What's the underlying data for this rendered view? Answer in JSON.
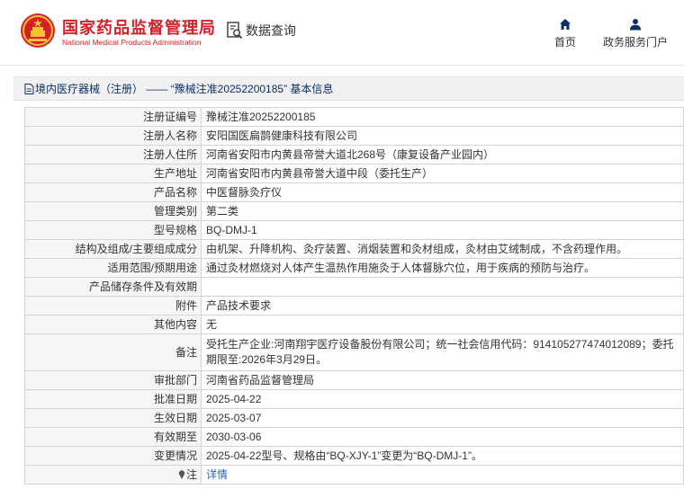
{
  "header": {
    "brand_cn": "国家药品监督管理局",
    "brand_en": "National Medical Products Administration",
    "query_label": "数据查询",
    "nav": [
      {
        "label": "首页",
        "icon": "home-icon"
      },
      {
        "label": "政务服务门户",
        "icon": "user-icon"
      }
    ]
  },
  "breadcrumb": {
    "text": "境内医疗器械（注册） —— “豫械注准20252200185” 基本信息"
  },
  "colors": {
    "brand_red": "#d4202a",
    "nav_blue": "#0b2f6b",
    "link_blue": "#2a64b6"
  },
  "rows": [
    {
      "key": "注册证编号",
      "value": "豫械注准20252200185"
    },
    {
      "key": "注册人名称",
      "value": "安阳国医扁鹊健康科技有限公司"
    },
    {
      "key": "注册人住所",
      "value": "河南省安阳市内黄县帝誉大道北268号（康复设备产业园内）"
    },
    {
      "key": "生产地址",
      "value": "河南省安阳市内黄县帝誉大道中段（委托生产）"
    },
    {
      "key": "产品名称",
      "value": "中医督脉灸疗仪"
    },
    {
      "key": "管理类别",
      "value": "第二类"
    },
    {
      "key": "型号规格",
      "value": "BQ-DMJ-1"
    },
    {
      "key": "结构及组成/主要组成成分",
      "value": "由机架、升降机构、灸疗装置、消烟装置和灸材组成，灸材由艾绒制成，不含药理作用。"
    },
    {
      "key": "适用范围/预期用途",
      "value": "通过灸材燃烧对人体产生温热作用施灸于人体督脉穴位，用于疾病的预防与治疗。"
    },
    {
      "key": "产品储存条件及有效期",
      "value": ""
    },
    {
      "key": "附件",
      "value": "产品技术要求"
    },
    {
      "key": "其他内容",
      "value": "无"
    },
    {
      "key": "备注",
      "value": "受托生产企业:河南翔宇医疗设备股份有限公司；统一社会信用代码：914105277474012089；委托期限至:2026年3月29日。"
    },
    {
      "key": "审批部门",
      "value": "河南省药品监督管理局"
    },
    {
      "key": "批准日期",
      "value": "2025-04-22"
    },
    {
      "key": "生效日期",
      "value": "2025-03-07"
    },
    {
      "key": "有效期至",
      "value": "2030-03-06"
    },
    {
      "key": "变更情况",
      "value": "2025-04-22型号、规格由“BQ-XJY-1”变更为“BQ-DMJ-1”。"
    },
    {
      "key": "注",
      "value": "详情"
    }
  ]
}
